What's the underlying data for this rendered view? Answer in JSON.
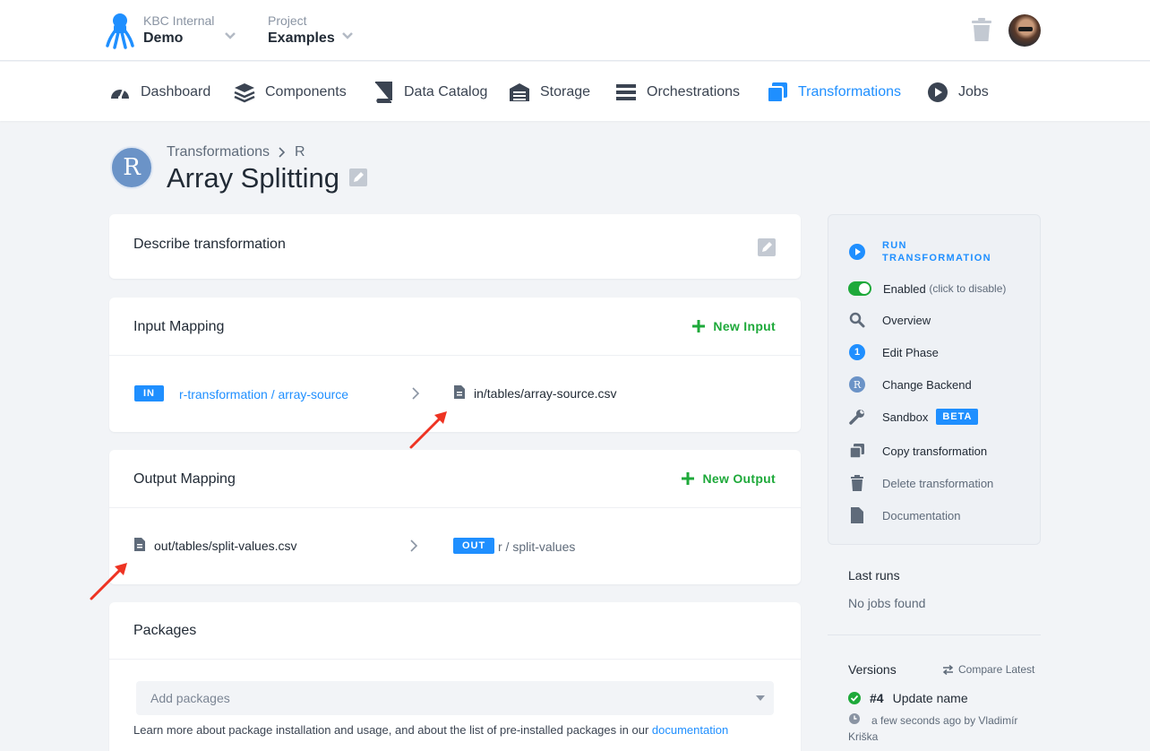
{
  "org": {
    "label": "KBC Internal",
    "name": "Demo"
  },
  "project": {
    "label": "Project",
    "name": "Examples"
  },
  "nav": [
    {
      "label": "Dashboard",
      "icon": "dashboard-icon"
    },
    {
      "label": "Components",
      "icon": "components-icon"
    },
    {
      "label": "Data Catalog",
      "icon": "book-icon"
    },
    {
      "label": "Storage",
      "icon": "storage-icon"
    },
    {
      "label": "Orchestrations",
      "icon": "orchestrations-icon"
    },
    {
      "label": "Transformations",
      "icon": "transformations-icon"
    },
    {
      "label": "Jobs",
      "icon": "play-icon"
    }
  ],
  "active_nav": "Transformations",
  "header": {
    "badge": "R",
    "breadcrumb": [
      "Transformations",
      "R"
    ],
    "title": "Array Splitting"
  },
  "describe": {
    "title": "Describe transformation"
  },
  "input_mapping": {
    "title": "Input Mapping",
    "action": "New Input",
    "tag": "IN",
    "source": "r-transformation / array-source",
    "destination": "in/tables/array-source.csv"
  },
  "output_mapping": {
    "title": "Output Mapping",
    "action": "New Output",
    "source": "out/tables/split-values.csv",
    "tag": "OUT",
    "destination": "r / split-values"
  },
  "packages": {
    "title": "Packages",
    "placeholder": "Add packages",
    "help_text": "Learn more about package installation and usage, and about the list of pre-installed packages in our ",
    "help_link": "documentation"
  },
  "sidebar": {
    "run": "RUN TRANSFORMATION",
    "enabled": "Enabled",
    "enabled_hint": "(click to disable)",
    "overview": "Overview",
    "phase_number": "1",
    "edit_phase": "Edit Phase",
    "change_backend": "Change Backend",
    "backend_badge": "R",
    "sandbox": "Sandbox",
    "beta": "BETA",
    "copy": "Copy transformation",
    "delete": "Delete transformation",
    "documentation": "Documentation"
  },
  "last_runs": {
    "title": "Last runs",
    "empty": "No jobs found"
  },
  "versions": {
    "title": "Versions",
    "compare": "Compare Latest",
    "latest_number": "#4",
    "latest_name": "Update name",
    "latest_meta": "a few seconds ago by Vladimír Kriška"
  },
  "colors": {
    "accent": "#1f8fff",
    "success": "#1ea93a",
    "annotation_arrow": "#ee3322"
  }
}
